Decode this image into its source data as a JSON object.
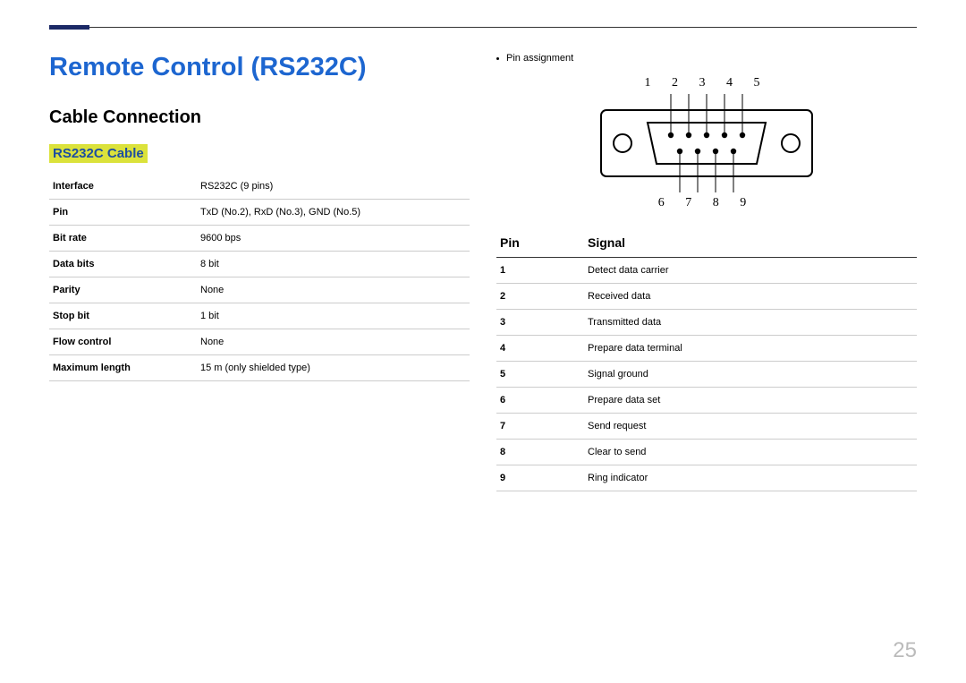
{
  "page_number": "25",
  "title_main": "Remote Control (RS232C)",
  "subsection": "Cable Connection",
  "highlight_title": "RS232C Cable",
  "spec": {
    "rows": [
      {
        "label": "Interface",
        "value": "RS232C (9 pins)"
      },
      {
        "label": "Pin",
        "value": "TxD (No.2), RxD (No.3), GND (No.5)"
      },
      {
        "label": "Bit rate",
        "value": "9600 bps"
      },
      {
        "label": "Data bits",
        "value": "8 bit"
      },
      {
        "label": "Parity",
        "value": "None"
      },
      {
        "label": "Stop bit",
        "value": "1 bit"
      },
      {
        "label": "Flow control",
        "value": "None"
      },
      {
        "label": "Maximum length",
        "value": "15 m (only shielded type)"
      }
    ]
  },
  "diagram": {
    "bullet_label": "Pin assignment",
    "top_numbers": "1 2 3 4 5",
    "bottom_numbers": "6 7 8 9"
  },
  "signal": {
    "header_pin": "Pin",
    "header_signal": "Signal",
    "rows": [
      {
        "pin": "1",
        "signal": "Detect data carrier"
      },
      {
        "pin": "2",
        "signal": "Received data"
      },
      {
        "pin": "3",
        "signal": "Transmitted data"
      },
      {
        "pin": "4",
        "signal": "Prepare data terminal"
      },
      {
        "pin": "5",
        "signal": "Signal ground"
      },
      {
        "pin": "6",
        "signal": "Prepare data set"
      },
      {
        "pin": "7",
        "signal": "Send request"
      },
      {
        "pin": "8",
        "signal": "Clear to send"
      },
      {
        "pin": "9",
        "signal": "Ring indicator"
      }
    ]
  }
}
